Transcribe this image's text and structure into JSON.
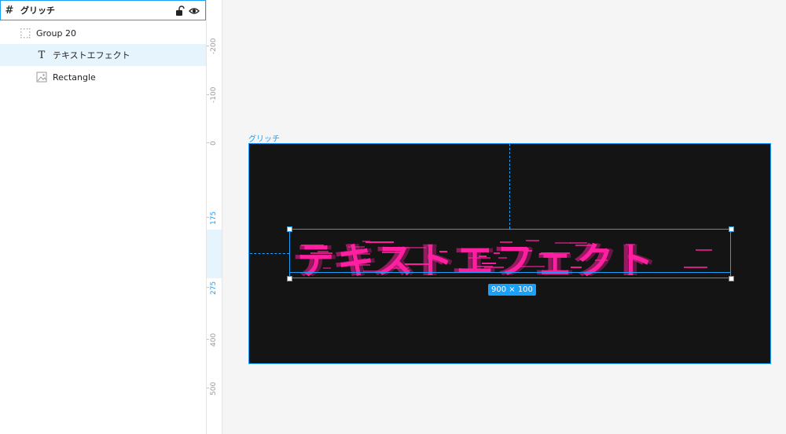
{
  "layers": {
    "frame": {
      "name": "グリッチ",
      "icon": "frame-grid-icon"
    },
    "group": {
      "name": "Group 20",
      "icon": "group-dots-icon"
    },
    "text": {
      "name": "テキストエフェクト",
      "icon": "text-icon",
      "glyph": "T"
    },
    "rect": {
      "name": "Rectangle",
      "icon": "image-icon"
    },
    "frame_icon_glyph": "#"
  },
  "ruler": {
    "ticks": [
      {
        "label": "-200",
        "highlight": false
      },
      {
        "label": "-100",
        "highlight": false
      },
      {
        "label": "0",
        "highlight": false
      },
      {
        "label": "175",
        "highlight": true
      },
      {
        "label": "275",
        "highlight": true
      },
      {
        "label": "400",
        "highlight": false
      },
      {
        "label": "500",
        "highlight": false
      }
    ]
  },
  "canvas": {
    "frame_label": "グリッチ",
    "text_content": "テキストエフェクト",
    "dimensions_badge": "900 × 100"
  },
  "colors": {
    "accent": "#18a0fb",
    "frame_bg": "#141414",
    "glitch_text": "#ff1fa0",
    "selected_row": "#e6f4fe"
  }
}
